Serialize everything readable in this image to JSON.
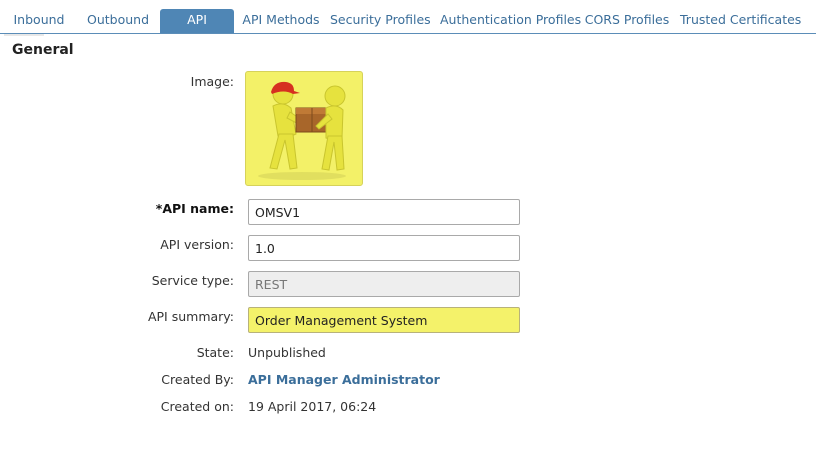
{
  "tabs": [
    {
      "label": "Inbound"
    },
    {
      "label": "Outbound"
    },
    {
      "label": "API"
    },
    {
      "label": "API Methods"
    },
    {
      "label": "Security Profiles"
    },
    {
      "label": "Authentication Profiles"
    },
    {
      "label": "CORS Profiles"
    },
    {
      "label": "Trusted Certificates"
    }
  ],
  "active_tab": "API",
  "section": {
    "title": "General"
  },
  "form": {
    "image_label": "Image:",
    "image_icon": "delivery-people-icon",
    "api_name_label": "*API name:",
    "api_name_value": "OMSV1",
    "api_version_label": "API version:",
    "api_version_value": "1.0",
    "service_type_label": "Service type:",
    "service_type_value": "REST",
    "api_summary_label": "API summary:",
    "api_summary_value": "Order Management System",
    "state_label": "State:",
    "state_value": "Unpublished",
    "created_by_label": "Created By:",
    "created_by_value": "API Manager Administrator",
    "created_on_label": "Created on:",
    "created_on_value": "19 April 2017, 06:24"
  },
  "colors": {
    "accent": "#4f86b5",
    "link": "#3b6e9a",
    "highlight": "#f4f26a"
  }
}
